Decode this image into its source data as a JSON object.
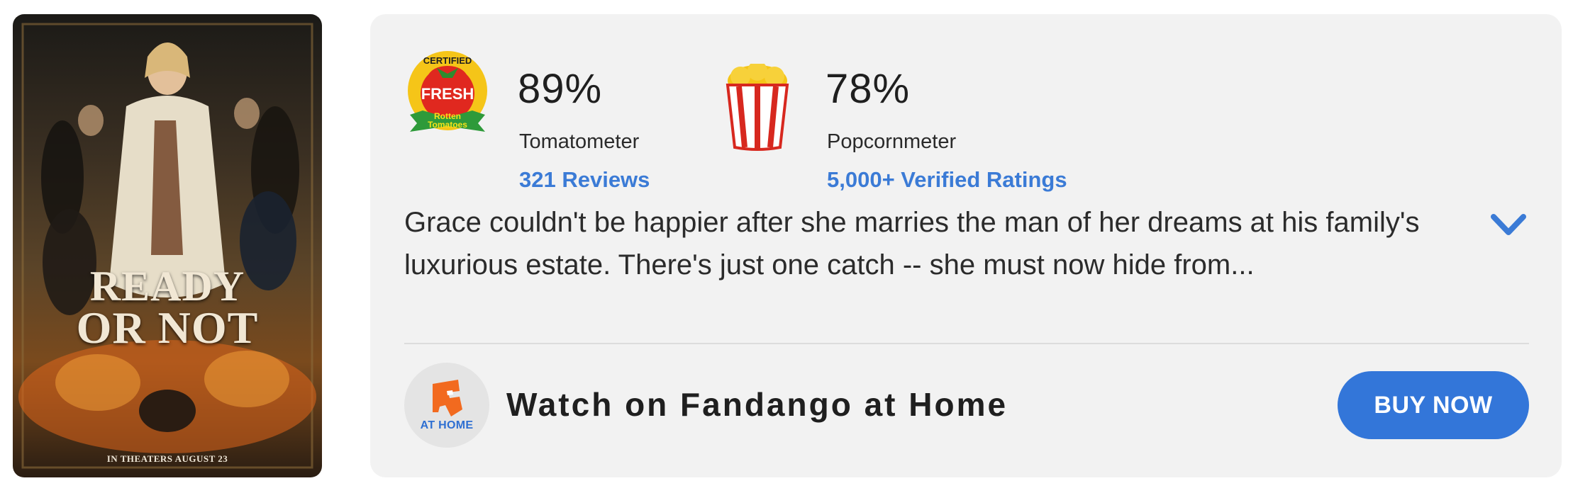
{
  "poster": {
    "title_line1": "READY",
    "title_line2": "OR NOT",
    "release_text": "IN THEATERS AUGUST 23"
  },
  "tomatometer": {
    "badge_top": "CERTIFIED",
    "badge_middle": "FRESH",
    "badge_bottom_1": "Rotten",
    "badge_bottom_2": "Tomatoes",
    "score": "89%",
    "label": "Tomatometer",
    "reviews_link": "321 Reviews"
  },
  "popcornmeter": {
    "score": "78%",
    "label": "Popcornmeter",
    "ratings_link": "5,000+ Verified Ratings"
  },
  "synopsis": "Grace couldn't be happier after she marries the man of her dreams at his family's luxurious estate. There's just one catch -- she must now hide from...",
  "watch": {
    "logo_label": "AT HOME",
    "label": "Watch on Fandango at Home",
    "buy_label": "BUY NOW"
  },
  "colors": {
    "link": "#3b7bd6",
    "button": "#3376d9",
    "card_bg": "#f2f2f2",
    "popcorn_red": "#d7281f",
    "popcorn_yellow": "#f5c518"
  }
}
